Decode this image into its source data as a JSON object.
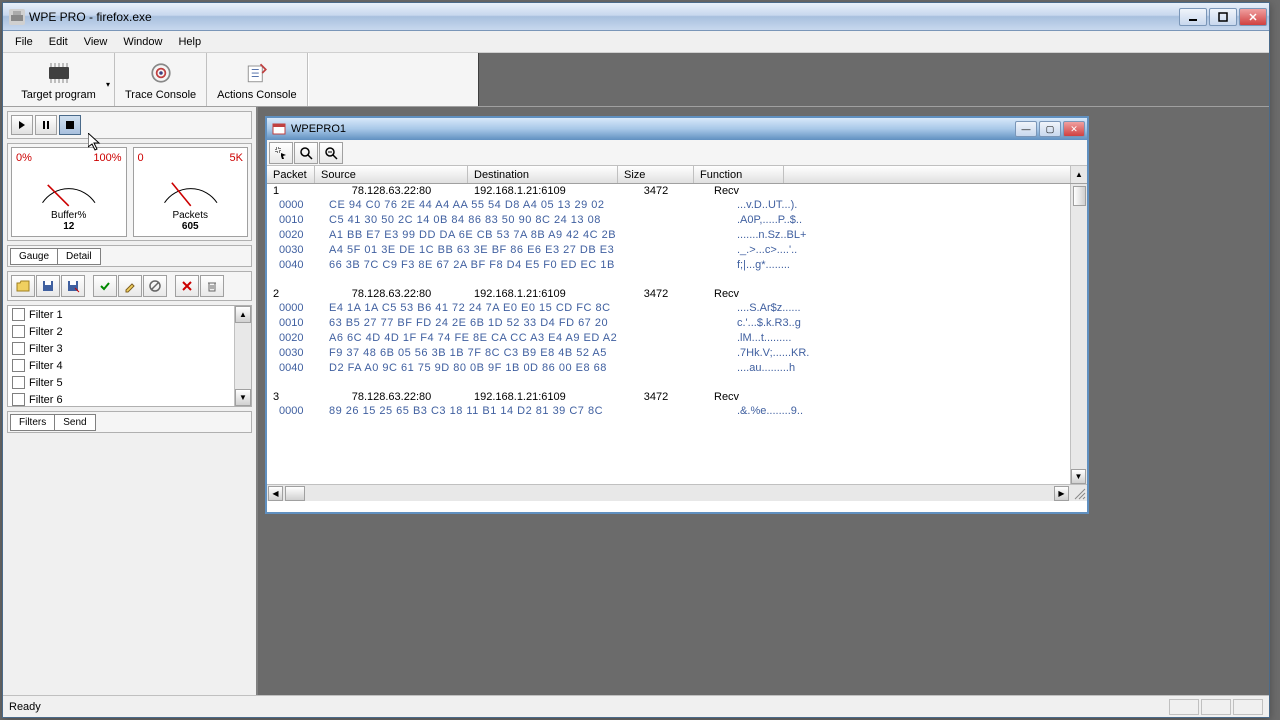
{
  "app": {
    "title": "WPE PRO - firefox.exe",
    "status": "Ready"
  },
  "menu": [
    "File",
    "Edit",
    "View",
    "Window",
    "Help"
  ],
  "toolbar": [
    {
      "label": "Target program",
      "drop": true
    },
    {
      "label": "Trace Console"
    },
    {
      "label": "Actions Console"
    }
  ],
  "gauges": {
    "buffer": {
      "min": "0%",
      "max": "100%",
      "label": "Buffer%",
      "value": "12"
    },
    "packets": {
      "min": "0",
      "max": "5K",
      "label": "Packets",
      "value": "605"
    }
  },
  "left_tabs1": [
    "Gauge",
    "Detail"
  ],
  "filters": [
    "Filter 1",
    "Filter 2",
    "Filter 3",
    "Filter 4",
    "Filter 5",
    "Filter 6"
  ],
  "left_tabs2": [
    "Filters",
    "Send"
  ],
  "child": {
    "title": "WPEPRO1",
    "columns": [
      "Packet",
      "Source",
      "Destination",
      "Size",
      "Function"
    ],
    "packets": [
      {
        "num": "1",
        "source": "78.128.63.22:80",
        "dest": "192.168.1.21:6109",
        "size": "3472",
        "func": "Recv",
        "hex": [
          {
            "off": "0000",
            "b": "CE 94 C0 76 2E 44 A4 AA 55 54 D8 A4 05 13 29 02",
            "a": "...v.D..UT...)."
          },
          {
            "off": "0010",
            "b": "C5 41 30 50 2C 14 0B 84 86 83 50 90 8C 24 13 08",
            "a": ".A0P,.....P..$.."
          },
          {
            "off": "0020",
            "b": "A1 BB E7 E3 99 DD DA 6E CB 53 7A 8B A9 42 4C 2B",
            "a": ".......n.Sz..BL+"
          },
          {
            "off": "0030",
            "b": "A4 5F 01 3E DE 1C BB 63 3E BF 86 E6 E3 27 DB E3",
            "a": "._.>...c>....'.."
          },
          {
            "off": "0040",
            "b": "66 3B 7C C9 F3 8E 67 2A BF F8 D4 E5 F0 ED EC 1B",
            "a": "f;|...g*........"
          }
        ]
      },
      {
        "num": "2",
        "source": "78.128.63.22:80",
        "dest": "192.168.1.21:6109",
        "size": "3472",
        "func": "Recv",
        "hex": [
          {
            "off": "0000",
            "b": "E4 1A 1A C5 53 B6 41 72 24 7A E0 E0 15 CD FC 8C",
            "a": "....S.Ar$z......"
          },
          {
            "off": "0010",
            "b": "63 B5 27 77 BF FD 24 2E 6B 1D 52 33 D4 FD 67 20",
            "a": "c.'...$.k.R3..g "
          },
          {
            "off": "0020",
            "b": "A6 6C 4D 4D 1F F4 74 FE 8E CA CC A3 E4 A9 ED A2",
            "a": ".lM...t........."
          },
          {
            "off": "0030",
            "b": "F9 37 48 6B 05 56 3B 1B 7F 8C C3 B9 E8 4B 52 A5",
            "a": ".7Hk.V;......KR."
          },
          {
            "off": "0040",
            "b": "D2 FA A0 9C 61 75 9D 80 0B 9F 1B 0D 86 00 E8 68",
            "a": "....au.........h"
          }
        ]
      },
      {
        "num": "3",
        "source": "78.128.63.22:80",
        "dest": "192.168.1.21:6109",
        "size": "3472",
        "func": "Recv",
        "hex": [
          {
            "off": "0000",
            "b": "89 26 15 25 65 B3 C3 18 11 B1 14 D2 81 39 C7 8C",
            "a": ".&.%e........9.."
          }
        ]
      }
    ]
  }
}
